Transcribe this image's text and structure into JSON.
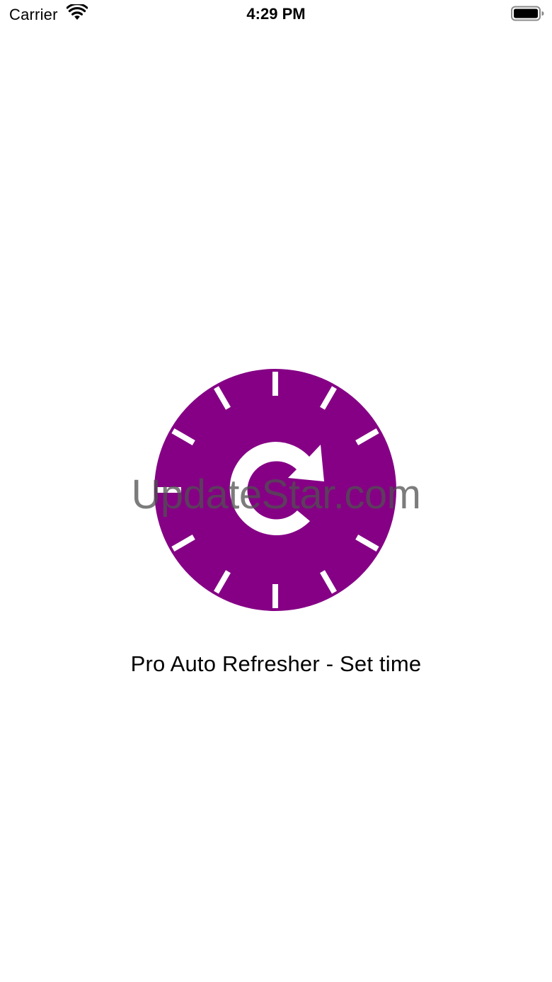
{
  "status_bar": {
    "carrier": "Carrier",
    "time": "4:29 PM",
    "icons": [
      "wifi-icon",
      "battery-icon"
    ]
  },
  "app": {
    "title": "Pro Auto Refresher - Set time",
    "icon": "refresh-clock-icon",
    "accent_color": "#850085"
  },
  "watermark": {
    "text": "UpdateStar.com"
  }
}
